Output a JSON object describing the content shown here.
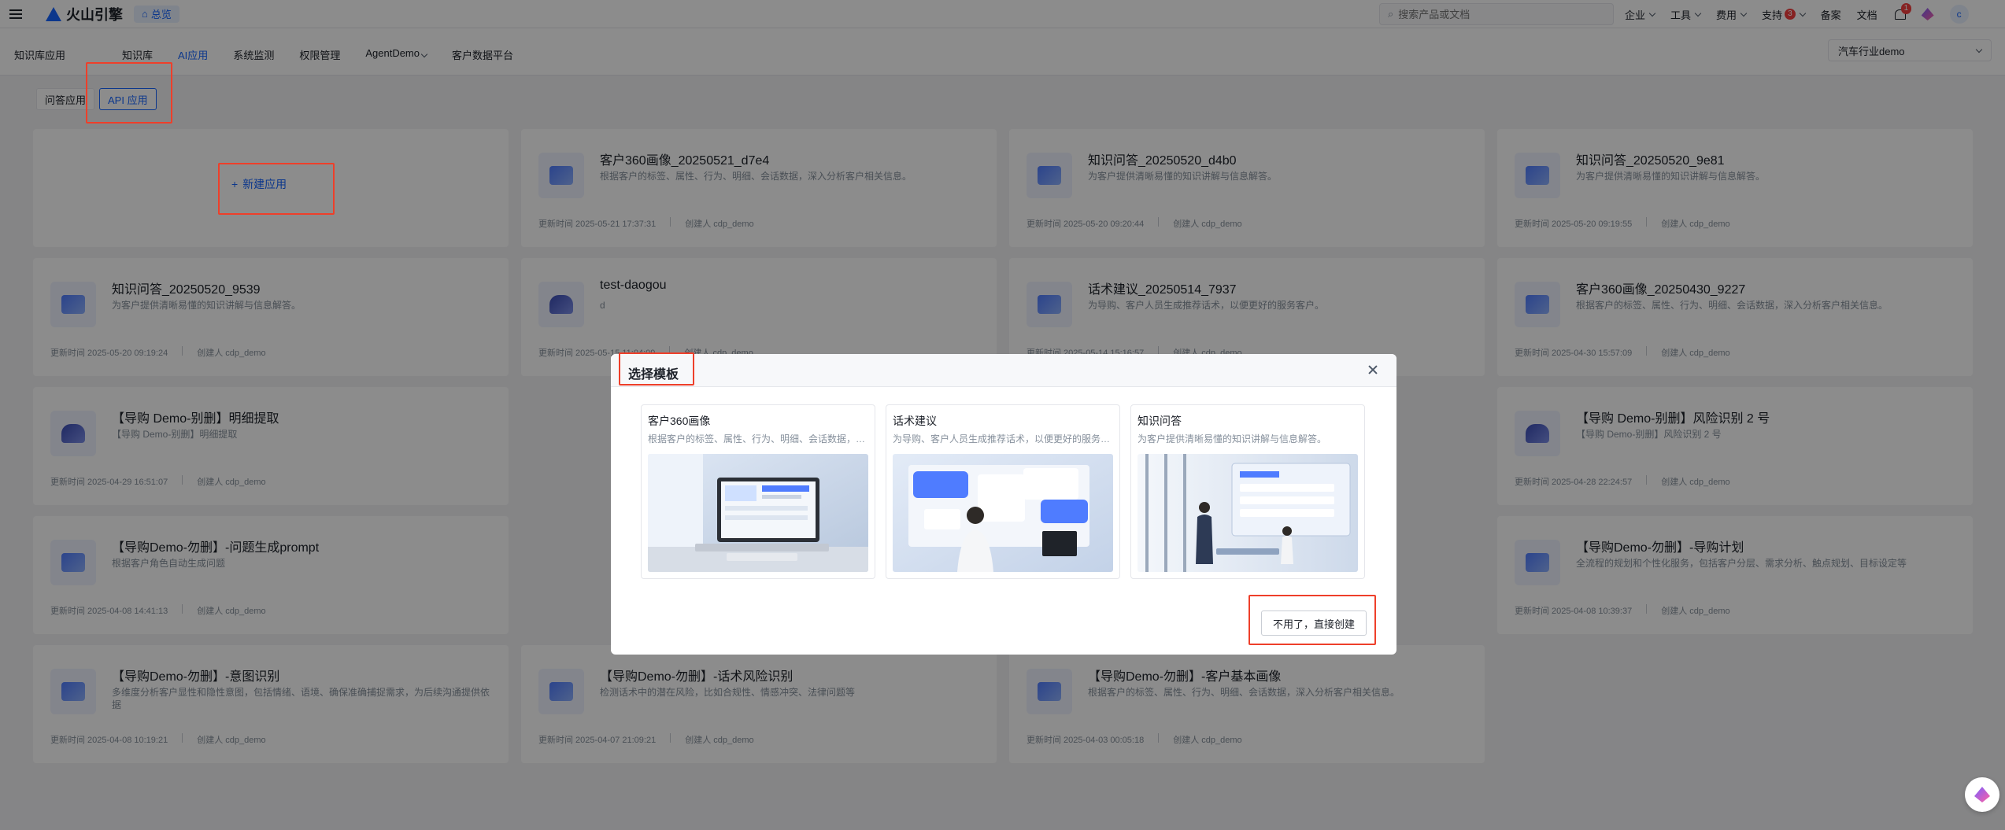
{
  "topbar": {
    "logo_text": "火山引擎",
    "home_label": "总览",
    "search_placeholder": "搜索产品或文档",
    "items": [
      "企业",
      "工具",
      "费用",
      "支持",
      "备案",
      "文档"
    ],
    "support_badge": "3",
    "bell_badge": "1",
    "avatar_letter": "c"
  },
  "subnav": {
    "section": "知识库应用",
    "tabs": [
      "知识库",
      "AI应用",
      "系统监测",
      "权限管理",
      "AgentDemo",
      "客户数据平台"
    ],
    "active_tab": "AI应用",
    "industry_select": "汽车行业demo"
  },
  "filters": [
    "问答应用",
    "API 应用"
  ],
  "new_app_label": "新建应用",
  "cards": [
    {
      "title": "客户360画像_20250521_d7e4",
      "desc": "根据客户的标签、属性、行为、明细、会话数据，深入分析客户相关信息。",
      "updated": "更新时间 2025-05-21 17:37:31",
      "creator": "创建人 cdp_demo"
    },
    {
      "title": "知识问答_20250520_d4b0",
      "desc": "为客户提供清晰易懂的知识讲解与信息解答。",
      "updated": "更新时间 2025-05-20 09:20:44",
      "creator": "创建人 cdp_demo"
    },
    {
      "title": "知识问答_20250520_9e81",
      "desc": "为客户提供清晰易懂的知识讲解与信息解答。",
      "updated": "更新时间 2025-05-20 09:19:55",
      "creator": "创建人 cdp_demo"
    },
    {
      "title": "知识问答_20250520_9539",
      "desc": "为客户提供清晰易懂的知识讲解与信息解答。",
      "updated": "更新时间 2025-05-20 09:19:24",
      "creator": "创建人 cdp_demo"
    },
    {
      "title": "test-daogou",
      "desc": "d",
      "updated": "更新时间 2025-05-15 11:04:09",
      "creator": "创建人 cdp_demo"
    },
    {
      "title": "话术建议_20250514_7937",
      "desc": "为导购、客户人员生成推荐话术，以便更好的服务客户。",
      "updated": "更新时间 2025-05-14 15:16:57",
      "creator": "创建人 cdp_demo"
    },
    {
      "title": "客户360画像_20250430_9227",
      "desc": "根据客户的标签、属性、行为、明细、会话数据，深入分析客户相关信息。",
      "updated": "更新时间 2025-04-30 15:57:09",
      "creator": "创建人 cdp_demo"
    },
    {
      "title": "【导购 Demo-别删】明细提取",
      "desc": "【导购 Demo-别删】明细提取",
      "updated": "更新时间 2025-04-29 16:51:07",
      "creator": "创建人 cdp_demo"
    },
    {
      "title": "【导购 Demo-别删】风险识别 2 号",
      "desc": "【导购 Demo-别删】风险识别 2 号",
      "updated": "更新时间 2025-04-28 22:24:57",
      "creator": "创建人 cdp_demo"
    },
    {
      "title": "【导购Demo-勿删】-问题生成prompt",
      "desc": "根据客户角色自动生成问题",
      "updated": "更新时间 2025-04-08 14:41:13",
      "creator": "创建人 cdp_demo"
    },
    {
      "title": "【导购Demo-勿删】-导购计划",
      "desc": "全流程的规划和个性化服务，包括客户分层、需求分析、触点规划、目标设定等",
      "updated": "更新时间 2025-04-08 10:39:37",
      "creator": "创建人 cdp_demo"
    },
    {
      "title": "【导购Demo-勿删】-意图识别",
      "desc": "多维度分析客户显性和隐性意图，包括情绪、语境、确保准确捕捉需求，为后续沟通提供依据",
      "updated": "更新时间 2025-04-08 10:19:21",
      "creator": "创建人 cdp_demo"
    },
    {
      "title": "【导购Demo-勿删】-话术风险识别",
      "desc": "检测话术中的潜在风险，比如合规性、情感冲突、法律问题等",
      "updated": "更新时间 2025-04-07 21:09:21",
      "creator": "创建人 cdp_demo"
    },
    {
      "title": "【导购Demo-勿删】-客户基本画像",
      "desc": "根据客户的标签、属性、行为、明细、会话数据，深入分析客户相关信息。",
      "updated": "更新时间 2025-04-03 00:05:18",
      "creator": "创建人 cdp_demo"
    }
  ],
  "modal": {
    "title": "选择模板",
    "templates": [
      {
        "title": "客户360画像",
        "desc": "根据客户的标签、属性、行为、明细、会话数据，深入分析客户相关信息。"
      },
      {
        "title": "话术建议",
        "desc": "为导购、客户人员生成推荐话术，以便更好的服务客户。"
      },
      {
        "title": "知识问答",
        "desc": "为客户提供清晰易懂的知识讲解与信息解答。"
      }
    ],
    "skip_label": "不用了，直接创建"
  },
  "colors": {
    "accent": "#1664ff",
    "annotation": "#ee3f2a"
  }
}
